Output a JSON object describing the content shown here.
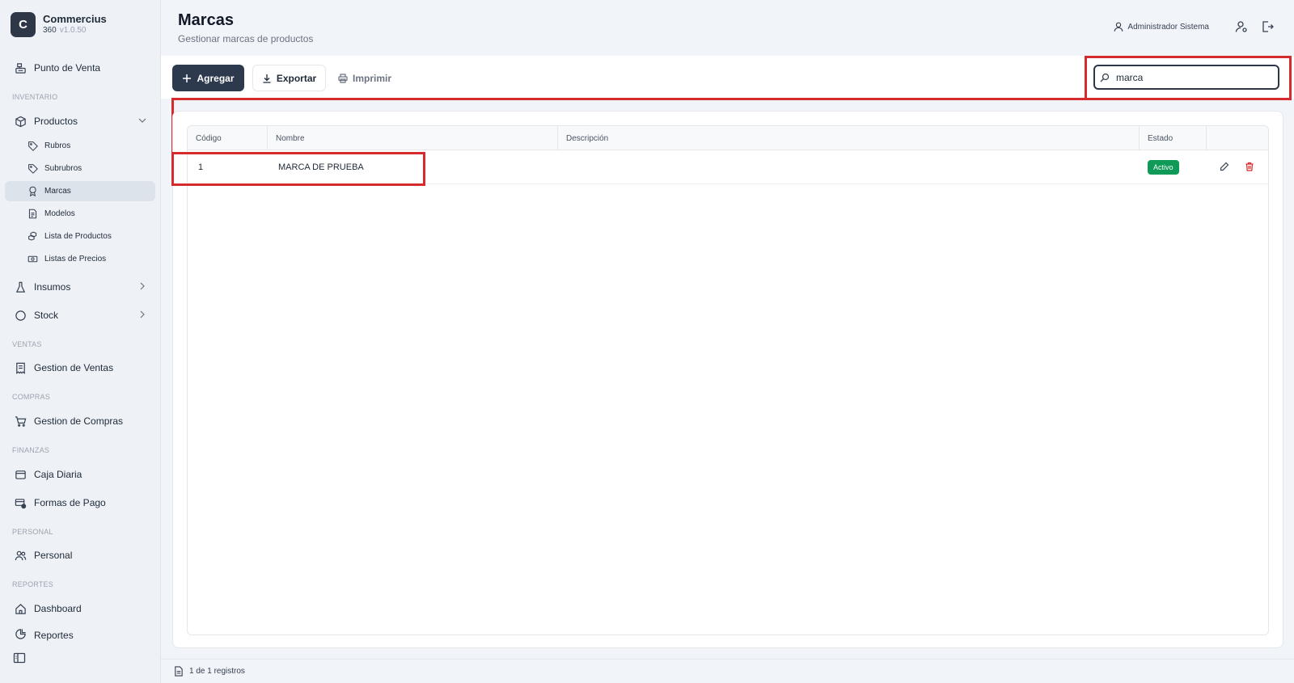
{
  "brand": {
    "logo_letter": "C",
    "name": "Commercius",
    "sub": "360",
    "version": "v1.0.50"
  },
  "sidebar": {
    "point_of_sale": "Punto de Venta",
    "sections": {
      "inventario": "INVENTARIO",
      "ventas": "VENTAS",
      "compras": "COMPRAS",
      "finanzas": "FINANZAS",
      "personal": "PERSONAL",
      "reportes": "REPORTES"
    },
    "productos": "Productos",
    "rubros": "Rubros",
    "subrubros": "Subrubros",
    "marcas": "Marcas",
    "modelos": "Modelos",
    "lista_productos": "Lista de Productos",
    "listas_precios": "Listas de Precios",
    "insumos": "Insumos",
    "stock": "Stock",
    "gestion_ventas": "Gestion de Ventas",
    "gestion_compras": "Gestion de Compras",
    "caja_diaria": "Caja Diaria",
    "formas_pago": "Formas de Pago",
    "personal": "Personal",
    "dashboard": "Dashboard",
    "reportes": "Reportes"
  },
  "header": {
    "title": "Marcas",
    "subtitle": "Gestionar marcas de productos",
    "user": "Administrador Sistema"
  },
  "toolbar": {
    "add_label": "Agregar",
    "export_label": "Exportar",
    "print_label": "Imprimir",
    "search_value": "marca"
  },
  "table": {
    "columns": [
      "Código",
      "Nombre",
      "Descripción",
      "Estado"
    ],
    "rows": [
      {
        "codigo": "1",
        "nombre": "MARCA DE PRUEBA",
        "descripcion": "",
        "estado": "Activo"
      }
    ]
  },
  "footer": {
    "records": "1 de 1 registros"
  },
  "colors": {
    "primary": "#2d3a4e",
    "active_badge": "#109a58",
    "highlight": "#d52b2e",
    "delete": "#dc2626"
  }
}
